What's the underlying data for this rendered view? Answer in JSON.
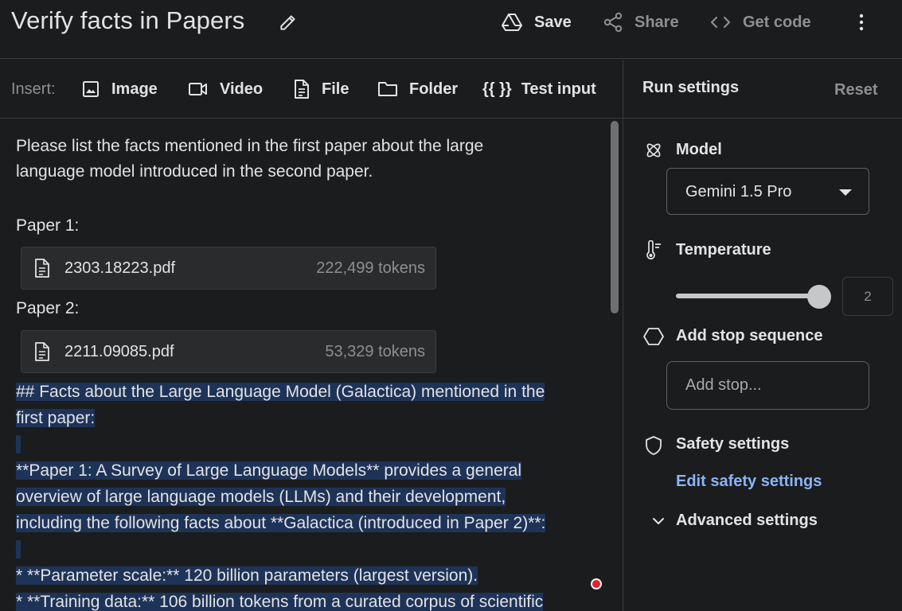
{
  "header": {
    "title": "Verify facts in Papers",
    "save_label": "Save",
    "share_label": "Share",
    "getcode_label": "Get code"
  },
  "toolbar": {
    "insert_label": "Insert:",
    "image_label": "Image",
    "video_label": "Video",
    "file_label": "File",
    "folder_label": "Folder",
    "test_input_braces": "{{ }}",
    "test_input_label": "Test input"
  },
  "prompt": {
    "instruction_line1": "Please list the facts mentioned in the first paper about the large",
    "instruction_line2": "language model introduced in the second paper.",
    "paper1_label": "Paper 1:",
    "paper2_label": "Paper 2:",
    "files": [
      {
        "name": "2303.18223.pdf",
        "tokens": "222,499 tokens"
      },
      {
        "name": "2211.09085.pdf",
        "tokens": "53,329 tokens"
      }
    ]
  },
  "response": {
    "lines": [
      " ## Facts about the Large Language Model (Galactica) mentioned in the",
      "first paper:",
      "**Paper 1: A Survey of Large Language Models** provides a general",
      "overview of large language models (LLMs) and their development,",
      "including the following facts about **Galactica (introduced in Paper 2)**:",
      "* **Parameter scale:** 120 billion parameters (largest version).",
      "* **Training data:** 106 billion tokens from a curated corpus of scientific"
    ]
  },
  "run_settings": {
    "title": "Run settings",
    "reset_label": "Reset",
    "model_label": "Model",
    "model_value": "Gemini 1.5 Pro",
    "temperature_label": "Temperature",
    "temperature_value": "2",
    "temperature_fraction": 1.0,
    "stop_label": "Add stop sequence",
    "stop_placeholder": "Add stop...",
    "safety_label": "Safety settings",
    "edit_safety_label": "Edit safety settings",
    "advanced_label": "Advanced settings"
  },
  "colors": {
    "background": "#1b1c1d",
    "selection": "#1e3358",
    "link": "#8ab4f8"
  }
}
